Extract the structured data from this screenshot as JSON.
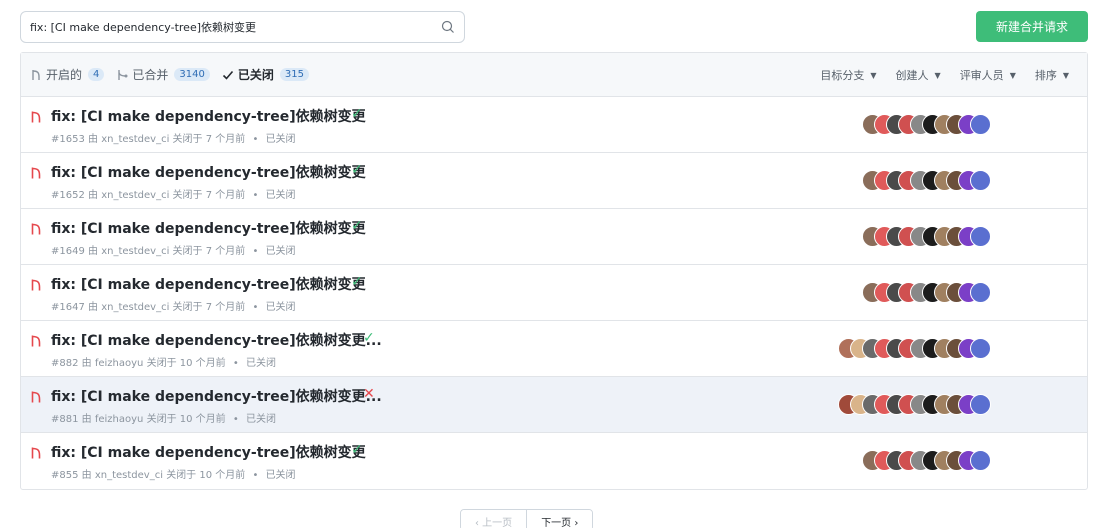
{
  "search": {
    "value": "fix: [CI make dependency-tree]依赖树变更",
    "placeholder": ""
  },
  "toolbar": {
    "new_mr_label": "新建合并请求"
  },
  "tabs": [
    {
      "label": "开启的",
      "count": "4"
    },
    {
      "label": "已合并",
      "count": "3140"
    },
    {
      "label": "已关闭",
      "count": "315"
    }
  ],
  "filters": [
    {
      "label": "目标分支"
    },
    {
      "label": "创建人"
    },
    {
      "label": "评审人员"
    },
    {
      "label": "排序"
    }
  ],
  "rows": [
    {
      "title": "fix: [CI make dependency-tree]依赖树变更",
      "status": "ok",
      "status_icon": "check-icon",
      "number": "#1653",
      "by": "由",
      "author": "xn_testdev_ci",
      "closed_at": "关闭于 7 个月前",
      "dot": "•",
      "state": "已关闭",
      "avatar_colors": [
        "#8a6d5a",
        "#e05a5a",
        "#4a4a4a",
        "#d05050",
        "#888",
        "#1c1c1c",
        "#a08060",
        "#6b4f3b",
        "#7b3fc7",
        "#5a6fd0"
      ]
    },
    {
      "title": "fix: [CI make dependency-tree]依赖树变更",
      "status": "ok",
      "status_icon": "check-icon",
      "number": "#1652",
      "by": "由",
      "author": "xn_testdev_ci",
      "closed_at": "关闭于 7 个月前",
      "dot": "•",
      "state": "已关闭",
      "avatar_colors": [
        "#8a6d5a",
        "#e05a5a",
        "#4a4a4a",
        "#d05050",
        "#888",
        "#1c1c1c",
        "#a08060",
        "#6b4f3b",
        "#7b3fc7",
        "#5a6fd0"
      ]
    },
    {
      "title": "fix: [CI make dependency-tree]依赖树变更",
      "status": "ok",
      "status_icon": "check-icon",
      "number": "#1649",
      "by": "由",
      "author": "xn_testdev_ci",
      "closed_at": "关闭于 7 个月前",
      "dot": "•",
      "state": "已关闭",
      "avatar_colors": [
        "#8a6d5a",
        "#e05a5a",
        "#4a4a4a",
        "#d05050",
        "#888",
        "#1c1c1c",
        "#a08060",
        "#6b4f3b",
        "#7b3fc7",
        "#5a6fd0"
      ]
    },
    {
      "title": "fix: [CI make dependency-tree]依赖树变更",
      "status": "ok",
      "status_icon": "check-icon",
      "number": "#1647",
      "by": "由",
      "author": "xn_testdev_ci",
      "closed_at": "关闭于 7 个月前",
      "dot": "•",
      "state": "已关闭",
      "avatar_colors": [
        "#8a6d5a",
        "#e05a5a",
        "#4a4a4a",
        "#d05050",
        "#888",
        "#1c1c1c",
        "#a08060",
        "#6b4f3b",
        "#7b3fc7",
        "#5a6fd0"
      ]
    },
    {
      "title": "fix: [CI make dependency-tree]依赖树变更...",
      "status": "ok",
      "status_icon": "check-icon",
      "number": "#882",
      "by": "由",
      "author": "feizhaoyu",
      "closed_at": "关闭于 10 个月前",
      "dot": "•",
      "state": "已关闭",
      "avatar_colors": [
        "#b0705a",
        "#d9b48a",
        "#6a6a6a",
        "#e05a5a",
        "#4a4a4a",
        "#d05050",
        "#888",
        "#1c1c1c",
        "#a08060",
        "#6b4f3b",
        "#7b3fc7",
        "#5a6fd0"
      ]
    },
    {
      "title": "fix: [CI make dependency-tree]依赖树变更...",
      "status": "fail",
      "status_icon": "cross-icon",
      "number": "#881",
      "by": "由",
      "author": "feizhaoyu",
      "closed_at": "关闭于 10 个月前",
      "dot": "•",
      "state": "已关闭",
      "avatar_colors": [
        "#a04a3a",
        "#d9b48a",
        "#6a6a6a",
        "#e05a5a",
        "#4a4a4a",
        "#d05050",
        "#888",
        "#1c1c1c",
        "#a08060",
        "#6b4f3b",
        "#7b3fc7",
        "#5a6fd0"
      ]
    },
    {
      "title": "fix: [CI make dependency-tree]依赖树变更",
      "status": "ok",
      "status_icon": "check-icon",
      "number": "#855",
      "by": "由",
      "author": "xn_testdev_ci",
      "closed_at": "关闭于 10 个月前",
      "dot": "•",
      "state": "已关闭",
      "avatar_colors": [
        "#8a6d5a",
        "#e05a5a",
        "#4a4a4a",
        "#d05050",
        "#888",
        "#1c1c1c",
        "#a08060",
        "#6b4f3b",
        "#7b3fc7",
        "#5a6fd0"
      ]
    }
  ],
  "pager": {
    "prev_label": "‹ 上一页",
    "next_label": "下一页 ›"
  },
  "colors": {
    "accent": "#3ebd79",
    "closed_icon": "#e5484d",
    "highlight_row": "#eef2f8"
  }
}
